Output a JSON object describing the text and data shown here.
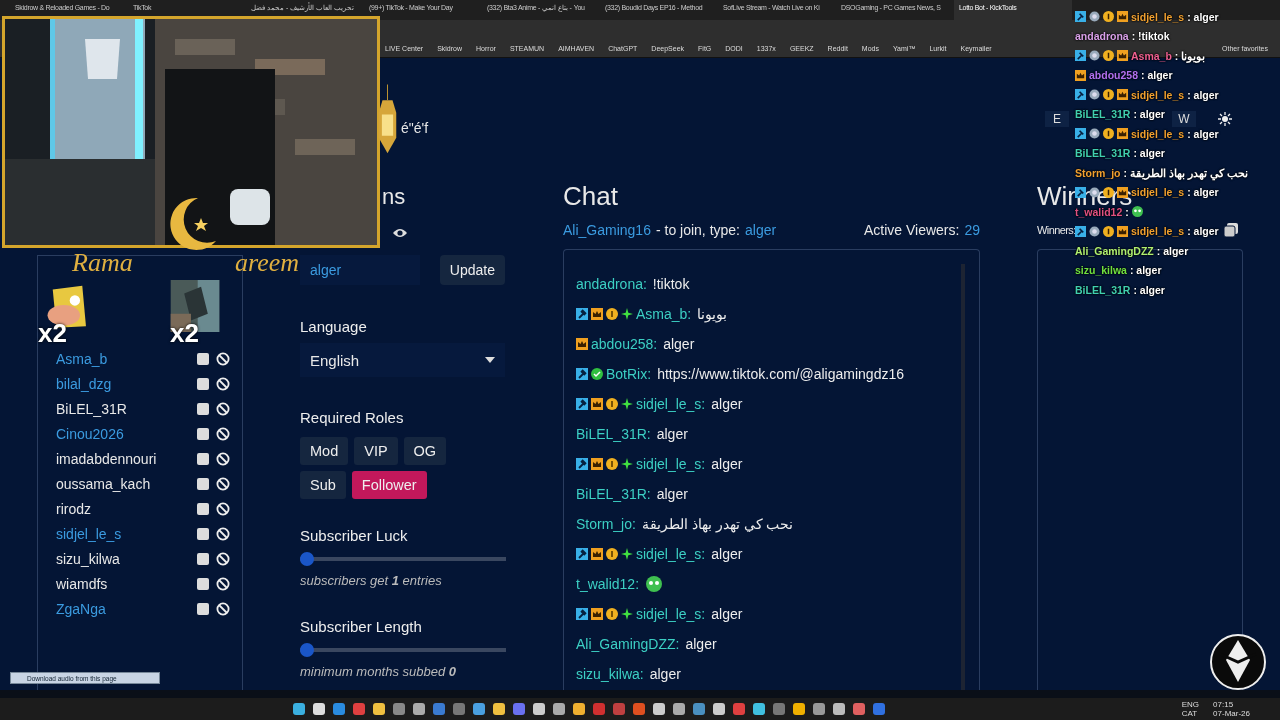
{
  "browser": {
    "tabs": [
      {
        "title": "Skidrow & Reloaded Games - Do",
        "selected": false
      },
      {
        "title": "TikTok",
        "selected": false
      },
      {
        "title": "تحريب العاب الأرشيف - محمد فضل",
        "selected": false
      },
      {
        "title": "(99+) TikTok - Make Your Day",
        "selected": false
      },
      {
        "title": "(332) Bta3 Anime - بتاع انمي - You",
        "selected": false
      },
      {
        "title": "(332) Boudid Days EP16 - Method",
        "selected": false
      },
      {
        "title": "SofLive Stream - Watch Live on Ki",
        "selected": false
      },
      {
        "title": "DSOGaming - PC Games News, S",
        "selected": false
      },
      {
        "title": "Lotto Bot - KickTools",
        "selected": true
      }
    ],
    "bookmarks": [
      "LIVE Center",
      "Skidrow",
      "Horror",
      "STEAMUN",
      "AIMHAVEN",
      "ChatGPT",
      "DeepSeek",
      "FitG",
      "DODI",
      "1337x",
      "GEEKZ",
      "Reddit",
      "Mods",
      "Yami™",
      "Lurkit",
      "Keymailer"
    ],
    "other_favorites": "Other favorites"
  },
  "entries": [
    {
      "name": "Asma_b",
      "color": "#3b9be0"
    },
    {
      "name": "bilal_dzg",
      "color": "#3b9be0"
    },
    {
      "name": "BiLEL_31R",
      "color": "#e8e8e8"
    },
    {
      "name": "Cinou2026",
      "color": "#3b9be0"
    },
    {
      "name": "imadabdennouri",
      "color": "#e8e8e8"
    },
    {
      "name": "oussama_kach",
      "color": "#e8e8e8"
    },
    {
      "name": "rirodz",
      "color": "#e8e8e8"
    },
    {
      "name": "sidjel_le_s",
      "color": "#3b9be0"
    },
    {
      "name": "sizu_kilwa",
      "color": "#e8e8e8"
    },
    {
      "name": "wiamdfs",
      "color": "#e8e8e8"
    },
    {
      "name": "ZgaNga",
      "color": "#3b9be0"
    }
  ],
  "options": {
    "stray_text": "é\"é'f",
    "heading_fragment": "ns",
    "keyword": "alger",
    "update": "Update",
    "language_label": "Language",
    "language": "English",
    "roles_label": "Required Roles",
    "roles": [
      {
        "label": "Mod",
        "selected": false
      },
      {
        "label": "VIP",
        "selected": false
      },
      {
        "label": "OG",
        "selected": false
      },
      {
        "label": "Sub",
        "selected": false
      },
      {
        "label": "Follower",
        "selected": true
      }
    ],
    "sliders": [
      {
        "label": "Subscriber Luck",
        "level": 0,
        "note": "subscribers get **1** entries"
      },
      {
        "label": "Subscriber Length",
        "level": 0,
        "note": "minimum months subbed **0**"
      }
    ]
  },
  "chat": {
    "title": "Chat",
    "streamer": "Ali_Gaming16",
    "join_text": "- to join, type:",
    "keyword": "alger",
    "viewers_label": "Active Viewers:",
    "viewers": "29",
    "messages": [
      {
        "user": "andadrona:",
        "text": "!tiktok"
      },
      {
        "badges": [
          {
            "kind": "mod"
          },
          {
            "kind": "crown"
          },
          {
            "kind": "sub"
          },
          {
            "kind": "star"
          }
        ],
        "user": "Asma_b:",
        "text": "بويونا"
      },
      {
        "badges": [
          {
            "kind": "crown"
          }
        ],
        "user": "abdou258:",
        "text": "alger"
      },
      {
        "badges": [
          {
            "kind": "mod"
          },
          {
            "kind": "verified"
          }
        ],
        "user": "BotRix:",
        "text": "https://www.tiktok.com/@aligamingdz16"
      },
      {
        "badges": [
          {
            "kind": "mod"
          },
          {
            "kind": "crown"
          },
          {
            "kind": "sub"
          },
          {
            "kind": "star"
          }
        ],
        "user": "sidjel_le_s:",
        "text": "alger"
      },
      {
        "user": "BiLEL_31R:",
        "text": "alger"
      },
      {
        "badges": [
          {
            "kind": "mod"
          },
          {
            "kind": "crown"
          },
          {
            "kind": "sub"
          },
          {
            "kind": "star"
          }
        ],
        "user": "sidjel_le_s:",
        "text": "alger"
      },
      {
        "user": "BiLEL_31R:",
        "text": "alger"
      },
      {
        "user": "Storm_jo:",
        "text": "نحب كي تهدر بهاذ الطريقة"
      },
      {
        "badges": [
          {
            "kind": "mod"
          },
          {
            "kind": "crown"
          },
          {
            "kind": "sub"
          },
          {
            "kind": "star"
          }
        ],
        "user": "sidjel_le_s:",
        "text": "alger"
      },
      {
        "user": "t_walid12:",
        "emote": true
      },
      {
        "badges": [
          {
            "kind": "mod"
          },
          {
            "kind": "crown"
          },
          {
            "kind": "sub"
          },
          {
            "kind": "star"
          }
        ],
        "user": "sidjel_le_s:",
        "text": "alger"
      },
      {
        "user": "Ali_GamingDZZ:",
        "text": "alger"
      },
      {
        "user": "sizu_kilwa:",
        "text": "alger"
      }
    ]
  },
  "winners": {
    "tools": [
      "E",
      "W"
    ],
    "title": "Winners",
    "label": "Winners:"
  },
  "overlay": {
    "ramadan": [
      "Rama",
      "areem"
    ],
    "emotes": [
      {
        "kind": "sticker",
        "count": "x2"
      },
      {
        "count": "x2"
      }
    ],
    "download_bar": "Download audio from this page",
    "stream_chat": [
      {
        "badges": [
          {
            "kind": "mod"
          },
          {
            "kind": "flower"
          },
          {
            "kind": "sub"
          },
          {
            "kind": "crown"
          }
        ],
        "user": "sidjel_le_s",
        "color": "#f0a030",
        "text": ": alger"
      },
      {
        "user": "andadrona",
        "color": "#d9a0e8",
        "text": ": !tiktok"
      },
      {
        "badges": [
          {
            "kind": "mod"
          },
          {
            "kind": "flower"
          },
          {
            "kind": "sub"
          },
          {
            "kind": "crown"
          }
        ],
        "user": "Asma_b",
        "color": "#f06090",
        "text": ": بويونا"
      },
      {
        "badges": [
          {
            "kind": "crown"
          }
        ],
        "user": "abdou258",
        "color": "#b070f0",
        "text": ": alger"
      },
      {
        "badges": [
          {
            "kind": "mod"
          },
          {
            "kind": "flower"
          },
          {
            "kind": "sub"
          },
          {
            "kind": "crown"
          }
        ],
        "user": "sidjel_le_s",
        "color": "#f0a030",
        "text": ": alger"
      },
      {
        "user": "BiLEL_31R",
        "color": "#40d0b0",
        "text": ": alger"
      },
      {
        "badges": [
          {
            "kind": "mod"
          },
          {
            "kind": "flower"
          },
          {
            "kind": "sub"
          },
          {
            "kind": "crown"
          }
        ],
        "user": "sidjel_le_s",
        "color": "#f0a030",
        "text": ": alger"
      },
      {
        "user": "BiLEL_31R",
        "color": "#40d0b0",
        "text": ": alger"
      },
      {
        "user": "Storm_jo",
        "color": "#f0a030",
        "text": ": نحب كي تهدر بهاذ الطريقة"
      },
      {
        "badges": [
          {
            "kind": "mod"
          },
          {
            "kind": "flower"
          },
          {
            "kind": "sub"
          },
          {
            "kind": "crown"
          }
        ],
        "user": "sidjel_le_s",
        "color": "#f0a030",
        "text": ": alger"
      },
      {
        "user": "t_walid12",
        "color": "#e05080",
        "text": ":",
        "emote": true
      },
      {
        "badges": [
          {
            "kind": "mod"
          },
          {
            "kind": "flower"
          },
          {
            "kind": "sub"
          },
          {
            "kind": "crown"
          }
        ],
        "user": "sidjel_le_s",
        "color": "#f0a030",
        "text": ": alger"
      },
      {
        "user": "Ali_GamingDZZ",
        "color": "#b0f070",
        "text": ": alger"
      },
      {
        "user": "sizu_kilwa",
        "color": "#70e040",
        "text": ": alger"
      },
      {
        "user": "BiLEL_31R",
        "color": "#40d0b0",
        "text": ": alger"
      }
    ]
  },
  "taskbar": {
    "language": "ENG",
    "layout": "CAT",
    "time": "07:15",
    "date": "07-Mar-26"
  }
}
